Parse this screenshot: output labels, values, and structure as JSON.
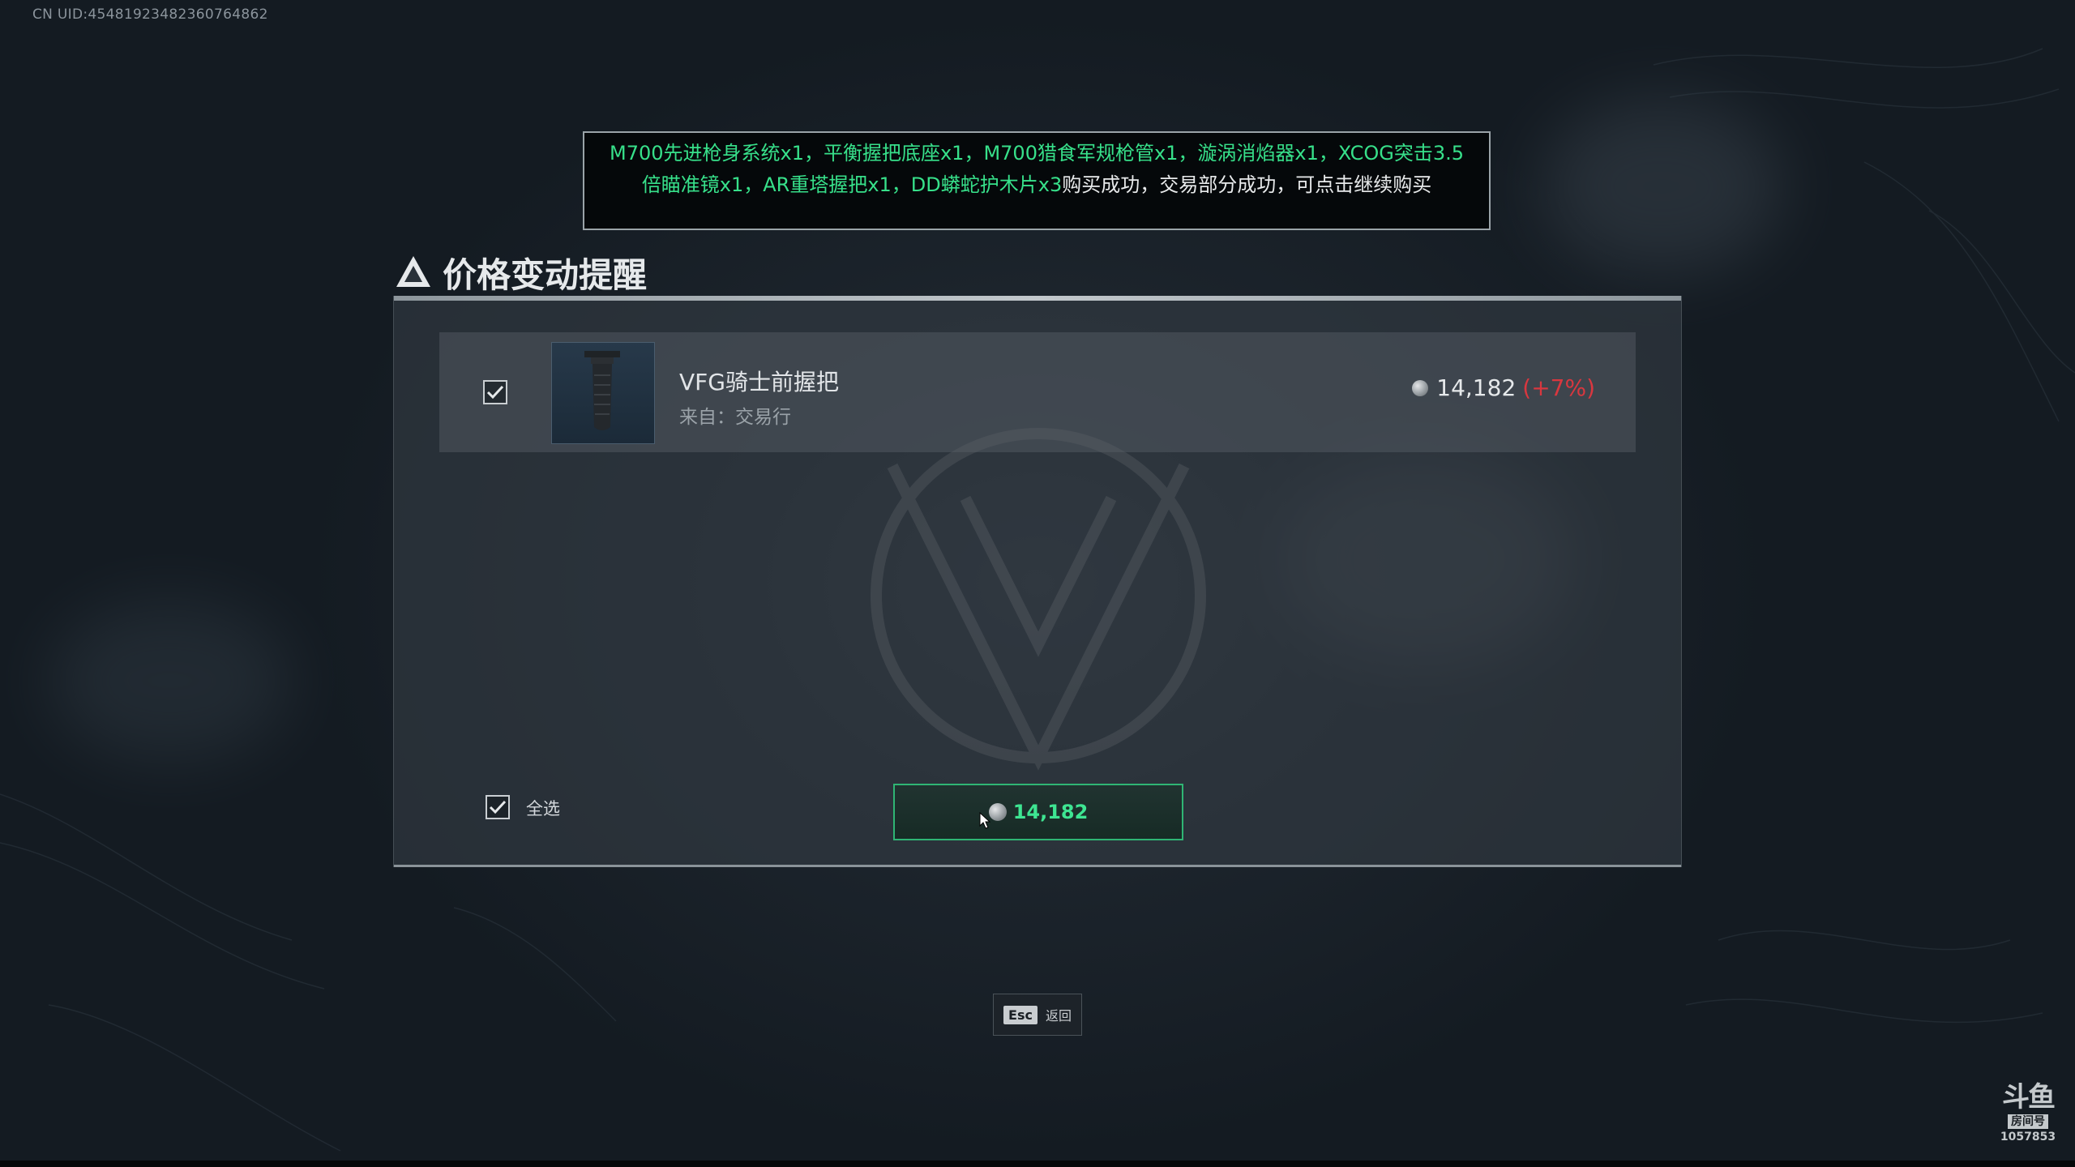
{
  "uid": {
    "text": "CN UID:454819234823607648​62"
  },
  "notice": {
    "items_text": "M700先进枪身系统x1，平衡握把底座x1，M700猎食军规枪管x1，漩涡消焰器x1，XCOG突击3.5倍瞄准镜x1，AR重塔握把x1，DD蟒蛇护木片x3",
    "result_text": "购买成功，交易部分成功，可点击继续购买",
    "highlight_color": "#37e08a"
  },
  "dialog": {
    "title": "价格变动提醒",
    "title_icon": "warning-triangle-icon",
    "item": {
      "checked": true,
      "name": "VFG骑士前握把",
      "source": "来自：交易行",
      "icon": "coin-icon",
      "price": "14,182",
      "price_change": "(+7%)",
      "price_change_color": "#d9373f"
    },
    "select_all": {
      "checked": true,
      "label": "全选"
    },
    "buy_button": {
      "icon": "coin-icon",
      "amount": "14,182",
      "accent_color": "#3ee592"
    }
  },
  "footer": {
    "esc_key": "Esc",
    "esc_label": "返回"
  },
  "watermark": {
    "logo": "斗鱼",
    "sub": "房间号",
    "room": "1057853"
  }
}
